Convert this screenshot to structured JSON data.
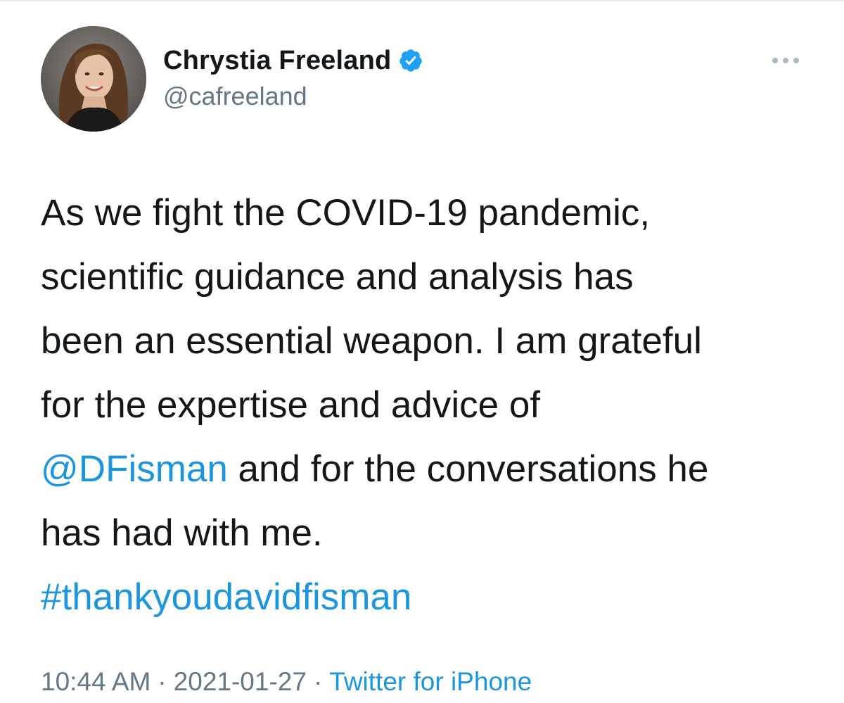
{
  "author": {
    "display_name": "Chrystia Freeland",
    "handle": "@cafreeland",
    "verified": true
  },
  "tweet": {
    "lines": [
      [
        {
          "text": "As we fight the COVID-19 pandemic,",
          "kind": "text"
        }
      ],
      [
        {
          "text": "scientific guidance and analysis has",
          "kind": "text"
        }
      ],
      [
        {
          "text": "been an essential weapon. I am grateful",
          "kind": "text"
        }
      ],
      [
        {
          "text": "for the expertise and advice of",
          "kind": "text"
        }
      ],
      [
        {
          "text": "@DFisman",
          "kind": "mention"
        },
        {
          "text": " and for the conversations he",
          "kind": "text"
        }
      ],
      [
        {
          "text": "has had with me.",
          "kind": "text"
        }
      ],
      [
        {
          "text": "#thankyoudavidfisman",
          "kind": "hashtag"
        }
      ]
    ]
  },
  "meta": {
    "time": "10:44 AM",
    "separator": "·",
    "date": "2021-01-27",
    "source": "Twitter for iPhone"
  },
  "icons": {
    "verified": "verified-badge-icon",
    "more": "more-options-icon"
  },
  "colors": {
    "link": "#1b95e0",
    "secondary_text": "#657786",
    "primary_text": "#14171a",
    "verified_badge": "#1da1f2"
  }
}
